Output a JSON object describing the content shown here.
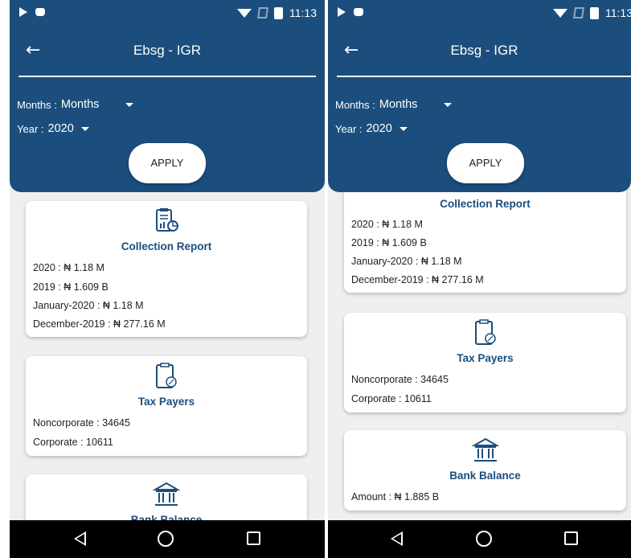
{
  "status": {
    "time": "11:13"
  },
  "app": {
    "title": "Ebsg - IGR"
  },
  "filters": {
    "months_label": "Months :",
    "months_value": "Months",
    "year_label": "Year :",
    "year_value": "2020",
    "apply_label": "APPLY"
  },
  "cards": {
    "collection": {
      "title": "Collection Report",
      "lines": [
        "2020 : ₦ 1.18 M",
        "2019 : ₦ 1.609 B",
        "January-2020 : ₦ 1.18 M",
        "December-2019 : ₦ 277.16 M"
      ]
    },
    "taxpayers": {
      "title": "Tax Payers",
      "lines": [
        "Noncorporate : 34645",
        "Corporate : 10611"
      ]
    },
    "bank": {
      "title": "Bank Balance",
      "lines": [
        "Amount : ₦ 1.885 B"
      ]
    }
  },
  "icons": {
    "back": "back-arrow-icon",
    "collection": "report-chart-icon",
    "taxpayers": "clipboard-percent-icon",
    "bank": "bank-building-icon"
  },
  "colors": {
    "primary": "#1b4e7d",
    "background": "#efefef"
  }
}
